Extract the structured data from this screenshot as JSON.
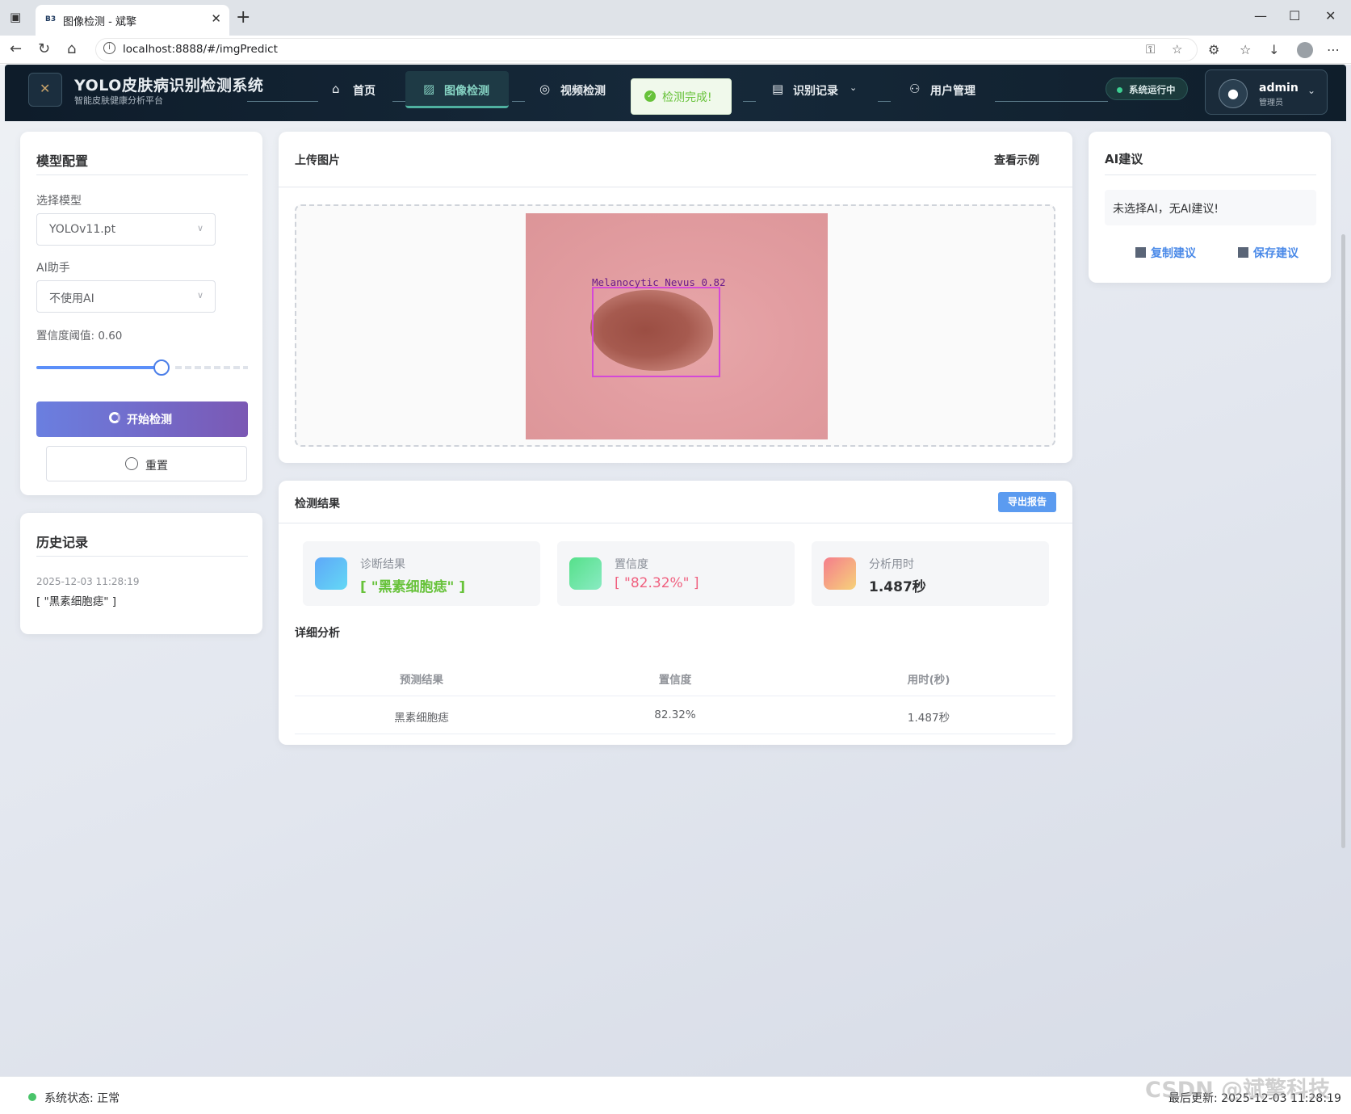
{
  "browser": {
    "tab_title": "图像检测 - 斌擎",
    "tab_favicon": "B3",
    "url": "localhost:8888/#/imgPredict"
  },
  "header": {
    "title": "YOLO皮肤病识别检测系统",
    "subtitle": "智能皮肤健康分析平台",
    "nav": [
      {
        "label": "首页",
        "icon": "home-icon"
      },
      {
        "label": "图像检测",
        "icon": "image-icon",
        "active": true
      },
      {
        "label": "视频检测",
        "icon": "play-icon"
      },
      {
        "label": "识别记录",
        "icon": "document-icon"
      },
      {
        "label": "用户管理",
        "icon": "user-icon"
      }
    ],
    "toast": "检测完成!",
    "system_status": "系统运行中",
    "user": {
      "name": "admin",
      "role": "管理员"
    }
  },
  "config": {
    "title": "模型配置",
    "model_label": "选择模型",
    "model_value": "YOLOv11.pt",
    "ai_label": "AI助手",
    "ai_value": "不使用AI",
    "threshold_label": "置信度阈值: 0.60",
    "threshold": 0.6,
    "start_button": "开始检测",
    "reset_button": "重置"
  },
  "history": {
    "title": "历史记录",
    "items": [
      {
        "time": "2025-12-03 11:28:19",
        "result": "[ \"黑素细胞痣\" ]"
      }
    ]
  },
  "upload": {
    "title": "上传图片",
    "example_link": "查看示例",
    "detection_label": "Melanocytic Nevus 0.82"
  },
  "results": {
    "title": "检测结果",
    "export_button": "导出报告",
    "stats": [
      {
        "key": "诊断结果",
        "value": "[ \"黑素细胞痣\" ]",
        "color": "#67c23a"
      },
      {
        "key": "置信度",
        "value": "[ \"82.32%\" ]",
        "color": "#f56c6c"
      },
      {
        "key": "分析用时",
        "value": "1.487秒",
        "color": "#303133"
      }
    ],
    "detail_title": "详细分析",
    "columns": [
      "预测结果",
      "置信度",
      "用时(秒)"
    ],
    "rows": [
      [
        "黑素细胞痣",
        "82.32%",
        "1.487秒"
      ]
    ]
  },
  "ai": {
    "title": "AI建议",
    "message": "未选择AI，无AI建议!",
    "copy": "复制建议",
    "save": "保存建议"
  },
  "footer": {
    "status": "系统状态: 正常",
    "updated": "最后更新: 2025-12-03 11:28:19",
    "watermark": "CSDN @斌擎科技"
  }
}
